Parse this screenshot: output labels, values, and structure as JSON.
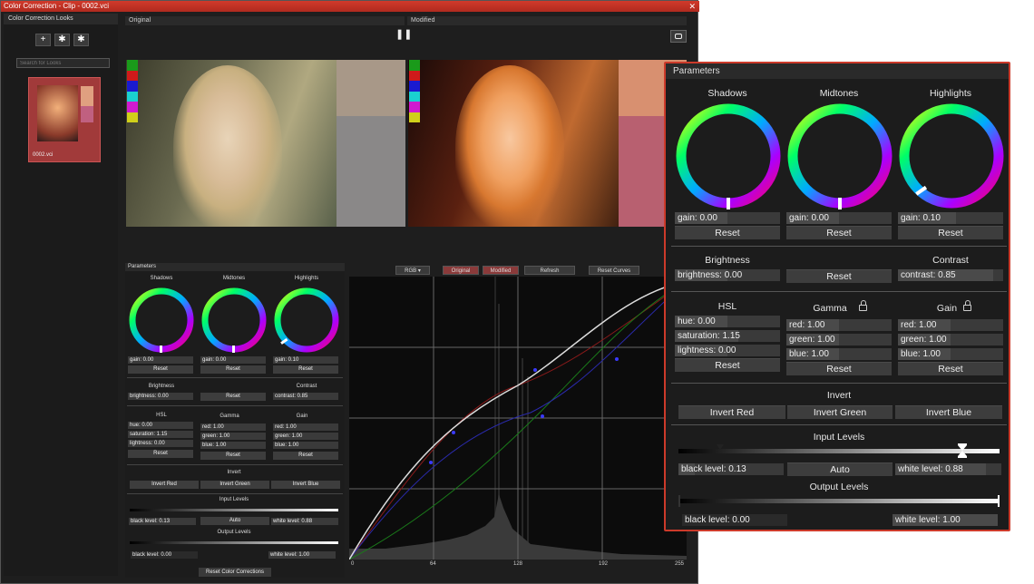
{
  "window": {
    "title": "Color Correction - Clip - 0002.vci",
    "close": "✕"
  },
  "looks": {
    "header": "Color Correction Looks",
    "buttons": [
      "+",
      "✱",
      "✱"
    ],
    "search_placeholder": "Search for Looks",
    "thumbnail_label": "0002.vci"
  },
  "viewer": {
    "original_label": "Original",
    "modified_label": "Modified",
    "pause_icon": "❚❚",
    "camera_icon": "📷",
    "swatch_colors": [
      "#1a9a1a",
      "#d01a1a",
      "#1a1ad0",
      "#1ad0d0",
      "#d01ad0",
      "#d0d01a"
    ]
  },
  "params": {
    "header": "Parameters",
    "shadows": "Shadows",
    "midtones": "Midtones",
    "highlights": "Highlights",
    "shadows_gain": "gain: 0.00",
    "midtones_gain": "gain: 0.00",
    "highlights_gain": "gain: 0.10",
    "reset": "Reset",
    "brightness": "Brightness",
    "brightness_value": "brightness: 0.00",
    "contrast": "Contrast",
    "contrast_value": "contrast: 0.85",
    "hsl": "HSL",
    "hue": "hue: 0.00",
    "saturation": "saturation: 1.15",
    "lightness": "lightness: 0.00",
    "gamma": "Gamma",
    "gamma_red": "red: 1.00",
    "gamma_green": "green: 1.00",
    "gamma_blue": "blue: 1.00",
    "gain": "Gain",
    "gain_red": "red: 1.00",
    "gain_green": "green: 1.00",
    "gain_blue": "blue: 1.00",
    "invert": "Invert",
    "invert_red": "Invert Red",
    "invert_green": "Invert Green",
    "invert_blue": "Invert Blue",
    "input_levels": "Input Levels",
    "input_black": "black level: 0.13",
    "auto": "Auto",
    "input_white": "white level: 0.88",
    "output_levels": "Output Levels",
    "output_black": "black level: 0.00",
    "output_white": "white level: 1.00",
    "reset_color_corrections": "Reset Color Corrections"
  },
  "curves": {
    "channel": "RGB",
    "original_btn": "Original",
    "modified_btn": "Modified",
    "refresh_btn": "Refresh",
    "reset_curves_btn": "Reset Curves",
    "axis_ticks": [
      "0",
      "64",
      "128",
      "192",
      "255"
    ]
  }
}
